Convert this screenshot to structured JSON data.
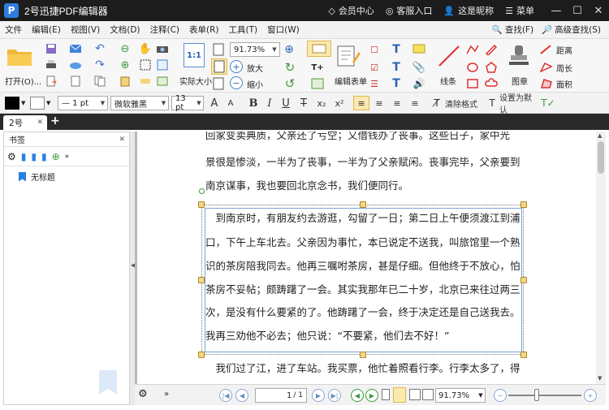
{
  "app": {
    "logo": "P",
    "title": "2号迅捷PDF编辑器"
  },
  "titlebar": {
    "links": [
      {
        "icon": "diamond-icon",
        "label": "会员中心"
      },
      {
        "icon": "headset-icon",
        "label": "客服入口"
      },
      {
        "icon": "user-icon",
        "label": "这是昵称"
      },
      {
        "icon": "menu-icon",
        "label": "菜单"
      }
    ],
    "minimize": "—",
    "maximize": "☐",
    "close": "✕"
  },
  "menu": {
    "items": [
      "文件",
      "编辑(E)",
      "视图(V)",
      "文档(D)",
      "注释(C)",
      "表单(R)",
      "工具(T)",
      "窗口(W)"
    ],
    "find": "查找(F)",
    "advanced_find": "高级查找(S)"
  },
  "ribbon": {
    "open_label": "打开(O)...",
    "actual_size_label": "实际大小",
    "actual_size_glyph": "1:1",
    "zoom_value": "91.73%",
    "zoom_in_label": "放大",
    "zoom_out_label": "缩小",
    "edit_form_label": "编辑表单",
    "lines_label": "线条",
    "stamp_label": "图章",
    "distance_label": "距离",
    "perimeter_label": "周长",
    "area_label": "面积"
  },
  "format": {
    "line_width": "— 1 pt",
    "font_name": "微软雅黑",
    "font_size": "13 pt",
    "clear_format": "清除格式",
    "set_default": "设置为默认"
  },
  "tabs": [
    {
      "label": "2号"
    }
  ],
  "sidebar": {
    "header": "书签",
    "bookmarks": [
      {
        "label": "无标题"
      }
    ]
  },
  "document": {
    "top_lines": [
      "回家变卖典质，父亲还了亏空；又借钱办了丧事。这些日子，家中光",
      "景很是惨淡，一半为了丧事，一半为了父亲赋闲。丧事完毕，父亲要到",
      "南京谋事，我也要回北京念书，我们便同行。"
    ],
    "selected_lines": [
      "　到南京时，有朋友约去游逛，勾留了一日；第二日上午便须渡江到浦",
      "口，下午上车北去。父亲因为事忙，本已说定不送我，叫旅馆里一个熟",
      "识的茶房陪我同去。他再三嘱咐茶房，甚是仔细。但他终于不放心，怕",
      "茶房不妥帖；颇踌躇了一会。其实我那年已二十岁，北京已来往过两三",
      "次，是没有什么要紧的了。他踌躇了一会，终于决定还是自己送我去。",
      "我再三劝他不必去；他只说：“不要紧，他们去不好！”"
    ],
    "bottom_lines": [
      "　我们过了江，进了车站。我买票，他忙着照看行李。行李太多了，得"
    ]
  },
  "status": {
    "page_value": "1",
    "page_total": "/ 1",
    "zoom": "91.73%"
  }
}
